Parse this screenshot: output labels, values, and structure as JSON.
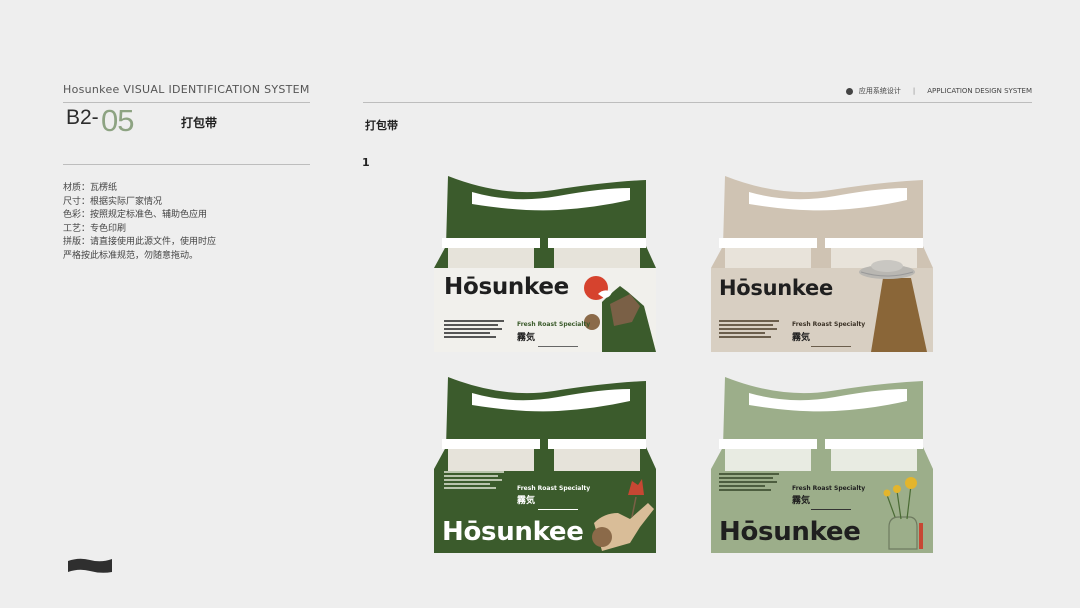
{
  "header": {
    "system_title": "Hosunkee VISUAL IDENTIFICATION SYSTEM",
    "right_cn": "应用系统设计",
    "right_sep": "|",
    "right_en": "APPLICATION DESIGN SYSTEM"
  },
  "section": {
    "code_prefix": "B2-",
    "code_number": "05",
    "title": "打包带"
  },
  "specs": [
    "材质：瓦楞纸",
    "尺寸：根据实际厂家情况",
    "色彩：按照规定标准色、辅助色应用",
    "工艺：专色印刷",
    "拼版：请直接使用此源文件，使用时应",
    "严格按此标准规范，勿随意拖动。"
  ],
  "main": {
    "title": "打包带",
    "item_number": "1"
  },
  "packs": [
    {
      "variant": "green-top",
      "brand": "Hōsunkee",
      "tagline": "Fresh Roast Specialty",
      "tagline_cn": "霧気",
      "illustration": "coffee-cup-mountain"
    },
    {
      "variant": "beige-top",
      "brand": "Hōsunkee",
      "tagline": "Fresh Roast Specialty",
      "tagline_cn": "霧気",
      "illustration": "ufo-beam"
    },
    {
      "variant": "green-bottom",
      "brand": "Hōsunkee",
      "tagline": "Fresh Roast Specialty",
      "tagline_cn": "霧気",
      "illustration": "hand-holding-flower"
    },
    {
      "variant": "sage-bottom",
      "brand": "Hōsunkee",
      "tagline": "Fresh Roast Specialty",
      "tagline_cn": "霧気",
      "illustration": "sunflower-vase"
    }
  ],
  "colors": {
    "green": "#3b5b2c",
    "beige": "#cfc3b3",
    "sage": "#9cae8a",
    "accent_number": "#8da382"
  }
}
